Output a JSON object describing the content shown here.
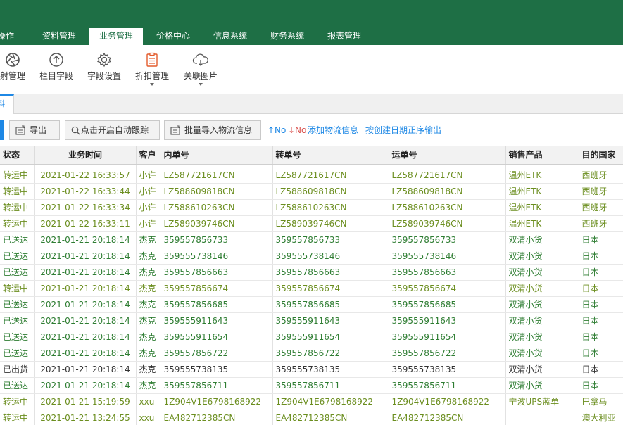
{
  "menu": {
    "items": [
      {
        "label": "操作"
      },
      {
        "label": "资料管理"
      },
      {
        "label": "业务管理"
      },
      {
        "label": "价格中心"
      },
      {
        "label": "信息系统"
      },
      {
        "label": "财务系统"
      },
      {
        "label": "报表管理"
      }
    ],
    "active_index": 2
  },
  "ribbon": {
    "items": [
      {
        "label": "射管理",
        "icon": "aperture-icon"
      },
      {
        "label": "栏目字段",
        "icon": "arrow-up-circle-icon"
      },
      {
        "label": "字段设置",
        "icon": "gear-icon"
      },
      {
        "label": "折扣管理",
        "icon": "clipboard-list-icon"
      },
      {
        "label": "关联图片",
        "icon": "cloud-link-icon"
      }
    ]
  },
  "tabs": {
    "active_label": "料"
  },
  "toolbar": {
    "export_label": "导出",
    "tracking_label": "点击开启自动跟踪",
    "import_label": "批量导入物流信息",
    "sort_asc_label": "↑No",
    "sort_desc_label": "↓No",
    "add_logistics_label": "添加物流信息",
    "sort_by_date_label": "按创建日期正序输出"
  },
  "colors": {
    "header_bg": "#1e6f45",
    "accent_blue": "#1e88e5",
    "sort_desc_red": "#d9534f",
    "status_transit": "#6b8e1f",
    "status_delivered": "#2e7d32"
  },
  "table": {
    "columns": [
      "状态",
      "业务时间",
      "客户",
      "内单号",
      "转单号",
      "运单号",
      "销售产品",
      "目的国家"
    ],
    "rows": [
      {
        "status": "转运中",
        "time": "2021-01-22 16:33:57",
        "customer": "小许",
        "inner_no": "LZ587721617CN",
        "transfer_no": "LZ587721617CN",
        "waybill_no": "LZ587721617CN",
        "product": "温州ETK",
        "country": "西班牙",
        "kind": "transit"
      },
      {
        "status": "转运中",
        "time": "2021-01-22 16:33:44",
        "customer": "小许",
        "inner_no": "LZ588609818CN",
        "transfer_no": "LZ588609818CN",
        "waybill_no": "LZ588609818CN",
        "product": "温州ETK",
        "country": "西班牙",
        "kind": "transit"
      },
      {
        "status": "转运中",
        "time": "2021-01-22 16:33:34",
        "customer": "小许",
        "inner_no": "LZ588610263CN",
        "transfer_no": "LZ588610263CN",
        "waybill_no": "LZ588610263CN",
        "product": "温州ETK",
        "country": "西班牙",
        "kind": "transit"
      },
      {
        "status": "转运中",
        "time": "2021-01-22 16:33:11",
        "customer": "小许",
        "inner_no": "LZ589039746CN",
        "transfer_no": "LZ589039746CN",
        "waybill_no": "LZ589039746CN",
        "product": "温州ETK",
        "country": "西班牙",
        "kind": "transit"
      },
      {
        "status": "已送达",
        "time": "2021-01-21 20:18:14",
        "customer": "杰克",
        "inner_no": "359557856733",
        "transfer_no": "359557856733",
        "waybill_no": "359557856733",
        "product": "双清小货",
        "country": "日本",
        "kind": "delivered"
      },
      {
        "status": "已送达",
        "time": "2021-01-21 20:18:14",
        "customer": "杰克",
        "inner_no": "359555738146",
        "transfer_no": "359555738146",
        "waybill_no": "359555738146",
        "product": "双清小货",
        "country": "日本",
        "kind": "delivered"
      },
      {
        "status": "已送达",
        "time": "2021-01-21 20:18:14",
        "customer": "杰克",
        "inner_no": "359557856663",
        "transfer_no": "359557856663",
        "waybill_no": "359557856663",
        "product": "双清小货",
        "country": "日本",
        "kind": "delivered"
      },
      {
        "status": "转运中",
        "time": "2021-01-21 20:18:14",
        "customer": "杰克",
        "inner_no": "359557856674",
        "transfer_no": "359557856674",
        "waybill_no": "359557856674",
        "product": "双清小货",
        "country": "日本",
        "kind": "transit"
      },
      {
        "status": "已送达",
        "time": "2021-01-21 20:18:14",
        "customer": "杰克",
        "inner_no": "359557856685",
        "transfer_no": "359557856685",
        "waybill_no": "359557856685",
        "product": "双清小货",
        "country": "日本",
        "kind": "delivered"
      },
      {
        "status": "已送达",
        "time": "2021-01-21 20:18:14",
        "customer": "杰克",
        "inner_no": "359555911643",
        "transfer_no": "359555911643",
        "waybill_no": "359555911643",
        "product": "双清小货",
        "country": "日本",
        "kind": "delivered"
      },
      {
        "status": "已送达",
        "time": "2021-01-21 20:18:14",
        "customer": "杰克",
        "inner_no": "359555911654",
        "transfer_no": "359555911654",
        "waybill_no": "359555911654",
        "product": "双清小货",
        "country": "日本",
        "kind": "delivered"
      },
      {
        "status": "已送达",
        "time": "2021-01-21 20:18:14",
        "customer": "杰克",
        "inner_no": "359557856722",
        "transfer_no": "359557856722",
        "waybill_no": "359557856722",
        "product": "双清小货",
        "country": "日本",
        "kind": "delivered"
      },
      {
        "status": "已出货",
        "time": "2021-01-21 20:18:14",
        "customer": "杰克",
        "inner_no": "359555738135",
        "transfer_no": "359555738135",
        "waybill_no": "359555738135",
        "product": "双清小货",
        "country": "日本",
        "kind": "shipped"
      },
      {
        "status": "已送达",
        "time": "2021-01-21 20:18:14",
        "customer": "杰克",
        "inner_no": "359557856711",
        "transfer_no": "359557856711",
        "waybill_no": "359557856711",
        "product": "双清小货",
        "country": "日本",
        "kind": "delivered"
      },
      {
        "status": "转运中",
        "time": "2021-01-21 15:19:59",
        "customer": "xxu",
        "inner_no": "1Z904V1E6798168922",
        "transfer_no": "1Z904V1E6798168922",
        "waybill_no": "1Z904V1E6798168922",
        "product": "宁波UPS蓝单",
        "country": "巴拿马",
        "kind": "transit"
      },
      {
        "status": "转运中",
        "time": "2021-01-21 13:24:55",
        "customer": "xxu",
        "inner_no": "EA482712385CN",
        "transfer_no": "EA482712385CN",
        "waybill_no": "EA482712385CN",
        "product": "",
        "country": "澳大利亚",
        "kind": "transit"
      }
    ]
  }
}
